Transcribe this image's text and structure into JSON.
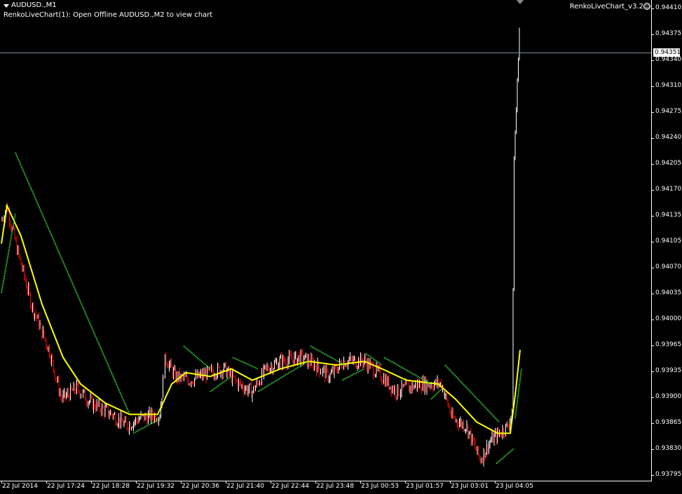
{
  "header": {
    "symbol_title": "AUDUSD.,M1",
    "indicator_message": "RenkoLiveChart(1): Open Offline AUDUSD.,M2 to view chart",
    "ea_name": "RenkoLiveChart_v3.2",
    "ea_status_icon": "smiley-face-icon"
  },
  "price_axis": {
    "labels": [
      "0.94410",
      "0.94375",
      "0.94340",
      "0.94310",
      "0.94275",
      "0.94240",
      "0.94205",
      "0.94170",
      "0.94135",
      "0.94105",
      "0.94070",
      "0.94035",
      "0.94000",
      "0.93965",
      "0.93935",
      "0.93900",
      "0.93865",
      "0.93830",
      "0.93795"
    ],
    "current_price": "0.94351"
  },
  "time_axis": {
    "labels": [
      "22 Jul 2014",
      "22 Jul 17:24",
      "22 Jul 18:28",
      "22 Jul 19:32",
      "22 Jul 20:36",
      "22 Jul 21:40",
      "22 Jul 22:44",
      "22 Jul 23:48",
      "23 Jul 00:53",
      "23 Jul 01:57",
      "23 Jul 03:01",
      "23 Jul 04:05"
    ]
  },
  "colors": {
    "background": "#000000",
    "bull_candle": "#ffffff",
    "bear_candle": "#ff0000",
    "moving_average": "#ffff00",
    "parabolic_sar": "#32cd32",
    "bid_line": "#7a8a9a"
  },
  "chart_data": {
    "type": "line",
    "instrument": "AUDUSD.",
    "timeframe": "M1",
    "ylim": [
      0.93795,
      0.9441
    ],
    "x": [
      "22 Jul 2014",
      "22 Jul 17:24",
      "22 Jul 18:28",
      "22 Jul 19:32",
      "22 Jul 20:36",
      "22 Jul 21:40",
      "22 Jul 22:44",
      "22 Jul 23:48",
      "23 Jul 00:53",
      "23 Jul 01:57",
      "23 Jul 03:01",
      "23 Jul 04:05"
    ],
    "series": [
      {
        "kind": "price",
        "values": [
          0.9415,
          0.9392,
          0.9388,
          0.9387,
          0.93935,
          0.9393,
          0.93945,
          0.9394,
          0.9394,
          0.9391,
          0.9384,
          0.9436
        ]
      },
      {
        "kind": "moving-average",
        "values": [
          0.9415,
          0.9393,
          0.93885,
          0.93875,
          0.93925,
          0.93925,
          0.9394,
          0.9394,
          0.93935,
          0.93915,
          0.93865,
          0.9396
        ]
      }
    ],
    "last_price": 0.94351
  }
}
